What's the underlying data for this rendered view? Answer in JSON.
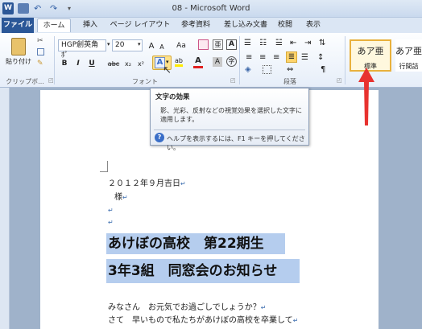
{
  "window": {
    "title": "08 - Microsoft Word"
  },
  "tabs": [
    "ファイル",
    "ホーム",
    "挿入",
    "ページ レイアウト",
    "参考資料",
    "差し込み文書",
    "校閲",
    "表示"
  ],
  "ribbon": {
    "paste_label": "貼り付け",
    "font_name": "HGP創英角ﾎﾟ",
    "font_size": "20",
    "groups": {
      "clipboard": "クリップボ...",
      "font": "フォント",
      "paragraph": "段落"
    },
    "style_preview": "あア亜",
    "styles": [
      {
        "label": "標準"
      },
      {
        "label": "行間詰"
      }
    ],
    "buttons": {
      "bold": "B",
      "italic": "I",
      "underline": "U",
      "strike": "abc",
      "sub": "x₂",
      "sup": "x²",
      "font_color": "A",
      "grow": "A",
      "shrink": "A",
      "aa": "Aa"
    }
  },
  "tooltip": {
    "title": "文字の効果",
    "description": "影、光彩、反射などの視覚効果を選択した文字に適用します。",
    "help": "ヘルプを表示するには、F1 キーを押してください。"
  },
  "document": {
    "date": "２０１２年９月吉日",
    "salutation": "様",
    "heading1": "あけぼの高校　第22期生",
    "heading2": "3年3組　同窓会のお知らせ",
    "body1": "みなさん　お元気でお過ごしでしょうか？",
    "body2": "さて　早いもので私たちがあけぼの高校を卒業して"
  },
  "colors": {
    "accent": "#2b5797",
    "highlight": "#b5cdee",
    "arrow": "#e8322f"
  }
}
